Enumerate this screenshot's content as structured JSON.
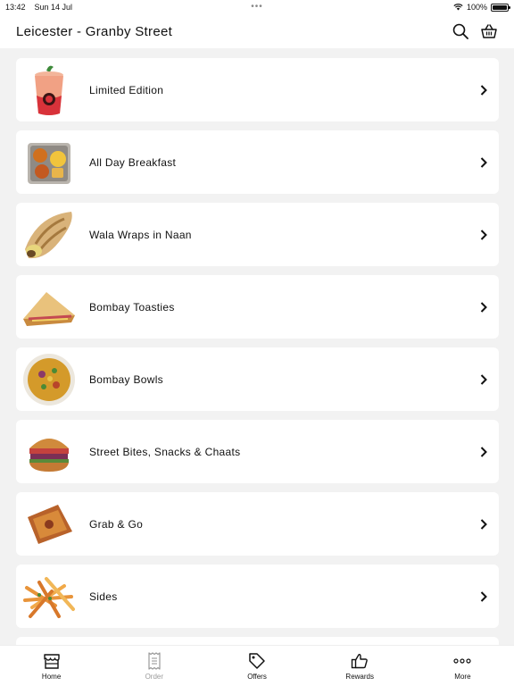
{
  "status_bar": {
    "time": "13:42",
    "date": "Sun 14 Jul",
    "battery": "100%",
    "battery_level": 1.0
  },
  "header": {
    "title": "Leicester - Granby Street",
    "search_icon": "search-icon",
    "basket_icon": "basket-icon"
  },
  "categories": [
    {
      "label": "Limited Edition",
      "image": "drink-cup"
    },
    {
      "label": "All Day Breakfast",
      "image": "breakfast-platter"
    },
    {
      "label": "Wala Wraps in Naan",
      "image": "naan-wrap"
    },
    {
      "label": "Bombay Toasties",
      "image": "toastie"
    },
    {
      "label": "Bombay Bowls",
      "image": "rice-bowl"
    },
    {
      "label": "Street Bites, Snacks & Chaats",
      "image": "bun-burger"
    },
    {
      "label": "Grab & Go",
      "image": "samosa-pastry"
    },
    {
      "label": "Sides",
      "image": "fries"
    }
  ],
  "tabbar": {
    "tabs": [
      {
        "label": "Home",
        "icon": "store-icon",
        "active": true
      },
      {
        "label": "Order",
        "icon": "receipt-icon",
        "active": false
      },
      {
        "label": "Offers",
        "icon": "tag-icon",
        "active": true
      },
      {
        "label": "Rewards",
        "icon": "thumbs-up-icon",
        "active": true
      },
      {
        "label": "More",
        "icon": "more-dots-icon",
        "active": true
      }
    ]
  },
  "colors": {
    "background": "#f2f2f2",
    "card": "#ffffff",
    "text": "#111111",
    "inactive": "#9a9a9a"
  }
}
